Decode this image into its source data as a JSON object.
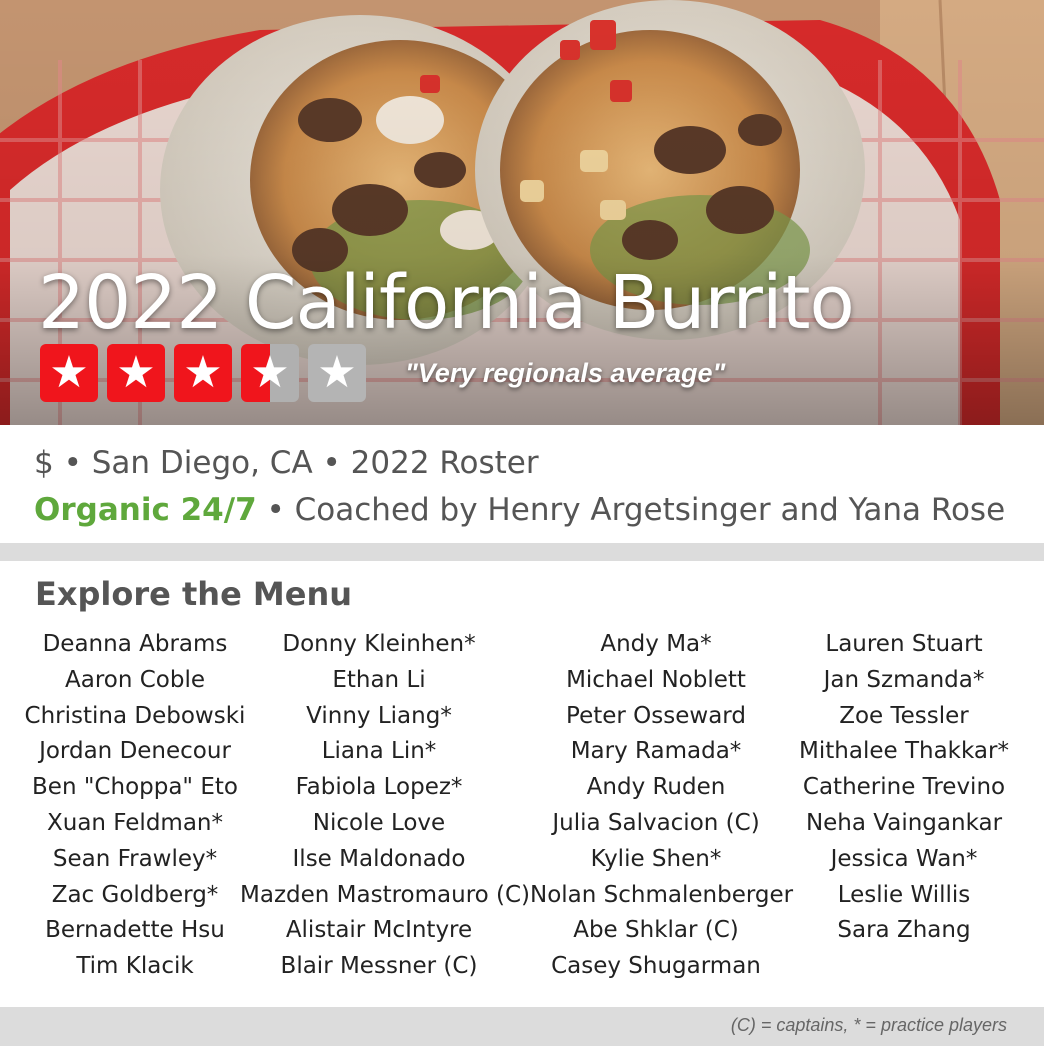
{
  "hero": {
    "title": "2022 California Burrito",
    "rating": 3.5,
    "rating_max": 5,
    "quote": "\"Very regionals average\""
  },
  "info": {
    "line1": "$ • San Diego, CA • 2022 Roster",
    "team": "Organic 24/7",
    "coaches": " • Coached by Henry Argetsinger and Yana Rose"
  },
  "menu": {
    "heading": "Explore the Menu",
    "columns": [
      [
        "Deanna Abrams",
        "Aaron Coble",
        "Christina Debowski",
        "Jordan Denecour",
        "Ben \"Choppa\" Eto",
        "Xuan Feldman*",
        "Sean Frawley*",
        "Zac Goldberg*",
        "Bernadette Hsu",
        "Tim Klacik"
      ],
      [
        "Donny Kleinhen*",
        "Ethan Li",
        "Vinny Liang*",
        "Liana Lin*",
        "Fabiola Lopez*",
        "Nicole Love",
        "Ilse Maldonado",
        "Mazden Mastromauro (C)",
        "Alistair McIntyre",
        "Blair Messner (C)"
      ],
      [
        "Andy Ma*",
        "Michael Noblett",
        "Peter Osseward",
        "Mary Ramada*",
        "Andy Ruden",
        "Julia Salvacion (C)",
        "Kylie Shen*",
        "Nolan Schmalenberger",
        "Abe Shklar (C)",
        "Casey Shugarman"
      ],
      [
        "Lauren Stuart",
        "Jan Szmanda*",
        "Zoe Tessler",
        "Mithalee Thakkar*",
        "Catherine Trevino",
        "Neha Vainganka r",
        "Jessica Wan*",
        "Leslie Willis",
        "Sara Zhang"
      ]
    ]
  },
  "footer": {
    "note": "(C) = captains, * = practice players"
  },
  "colors": {
    "star_red": "#f0151c",
    "star_grey": "#b4b4b4",
    "team_green": "#5fa83c",
    "band_grey": "#dcdcdc"
  },
  "icons": [
    "star-icon"
  ]
}
